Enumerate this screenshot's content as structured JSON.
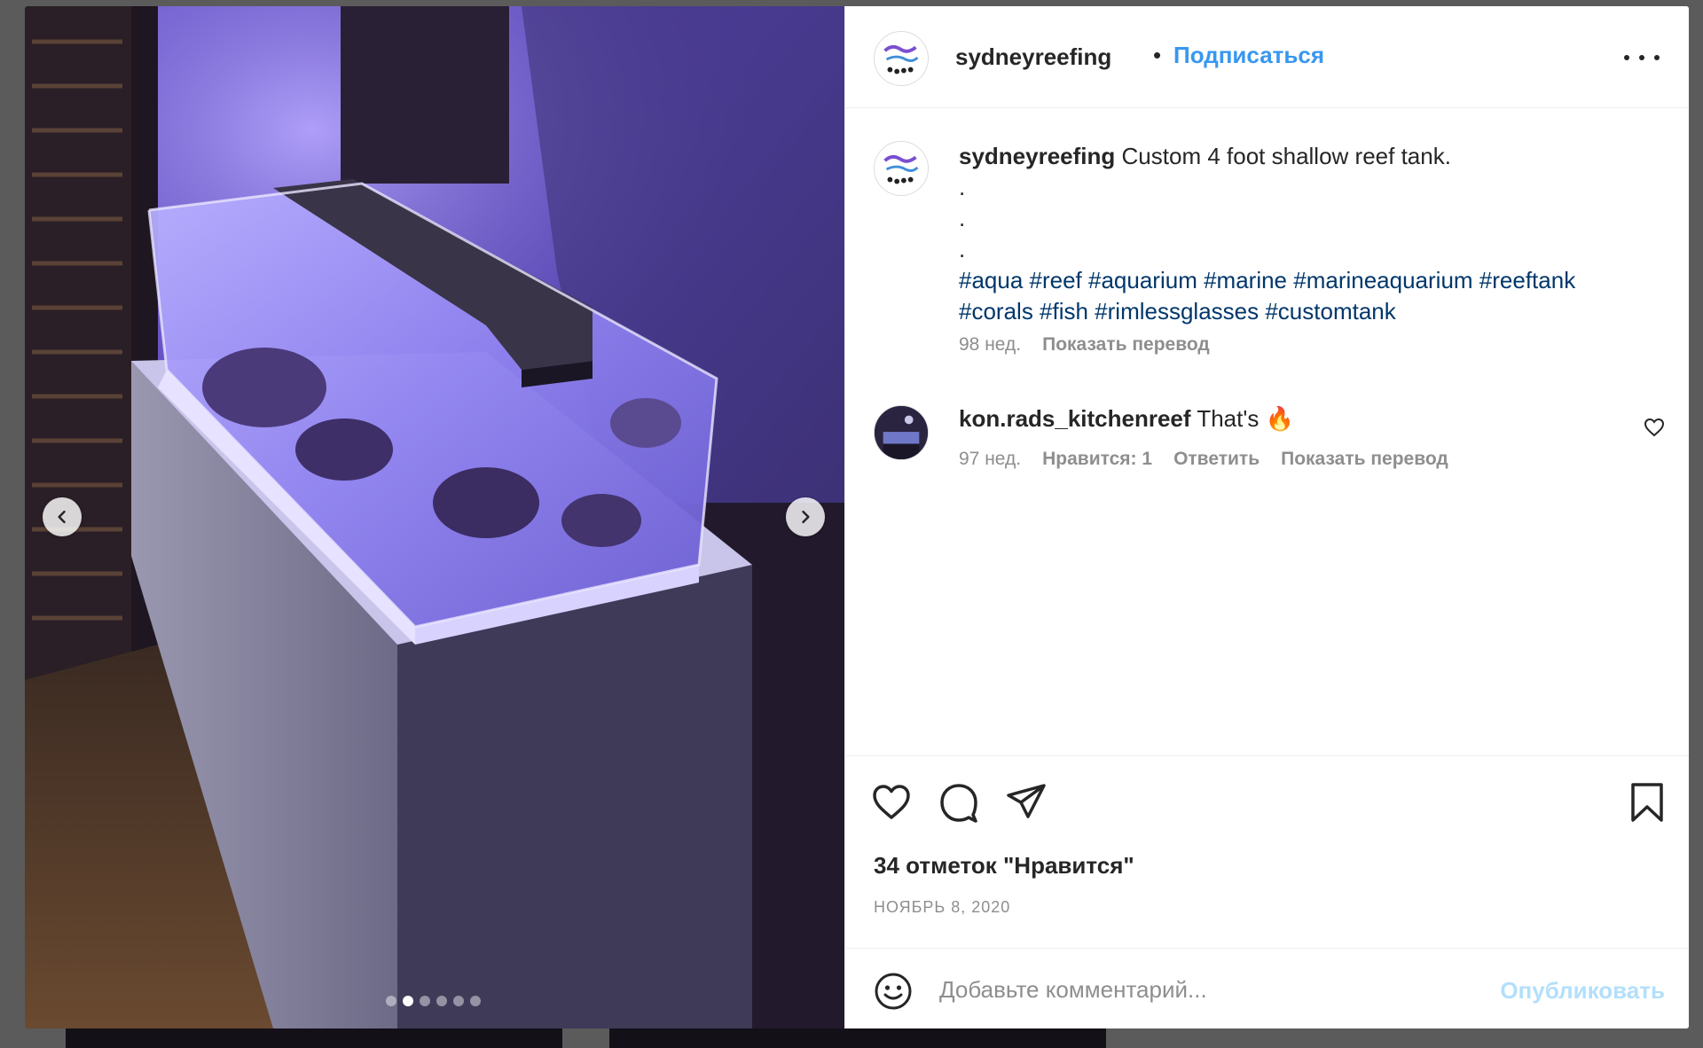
{
  "post": {
    "username": "sydneyreefing",
    "separator": "•",
    "follow_label": "Подписаться",
    "more_icon": "more-horizontal-icon"
  },
  "media": {
    "carousel_count": 6,
    "active_index": 1,
    "prev_icon": "chevron-left-icon",
    "next_icon": "chevron-right-icon"
  },
  "caption": {
    "username": "sydneyreefing",
    "text": "Custom 4 foot shallow reef tank.",
    "dot_lines": [
      ".",
      ".",
      "."
    ],
    "hashtags_line1": "#aqua #reef #aquarium #marine #marineaquarium #reeftank",
    "hashtags_line2": "#corals #fish #rimlessglasses #customtank",
    "age": "98 нед.",
    "translate_label": "Показать перевод"
  },
  "comment": {
    "username": "kon.rads_kitchenreef",
    "text": "That's 🔥",
    "age": "97 нед.",
    "likes_label": "Нравится: 1",
    "reply_label": "Ответить",
    "translate_label": "Показать перевод"
  },
  "actions": {
    "likes_text": "34 отметок \"Нравится\"",
    "date": "НОЯБРЬ 8, 2020",
    "icons": [
      "heart-icon",
      "comment-icon",
      "share-icon",
      "bookmark-icon"
    ]
  },
  "composer": {
    "placeholder": "Добавьте комментарий...",
    "post_label": "Опубликовать"
  },
  "colors": {
    "link_blue": "#3897f0",
    "hashtag_blue": "#00376b",
    "muted": "#8e8e8e",
    "post_disabled": "#b2dffc"
  }
}
